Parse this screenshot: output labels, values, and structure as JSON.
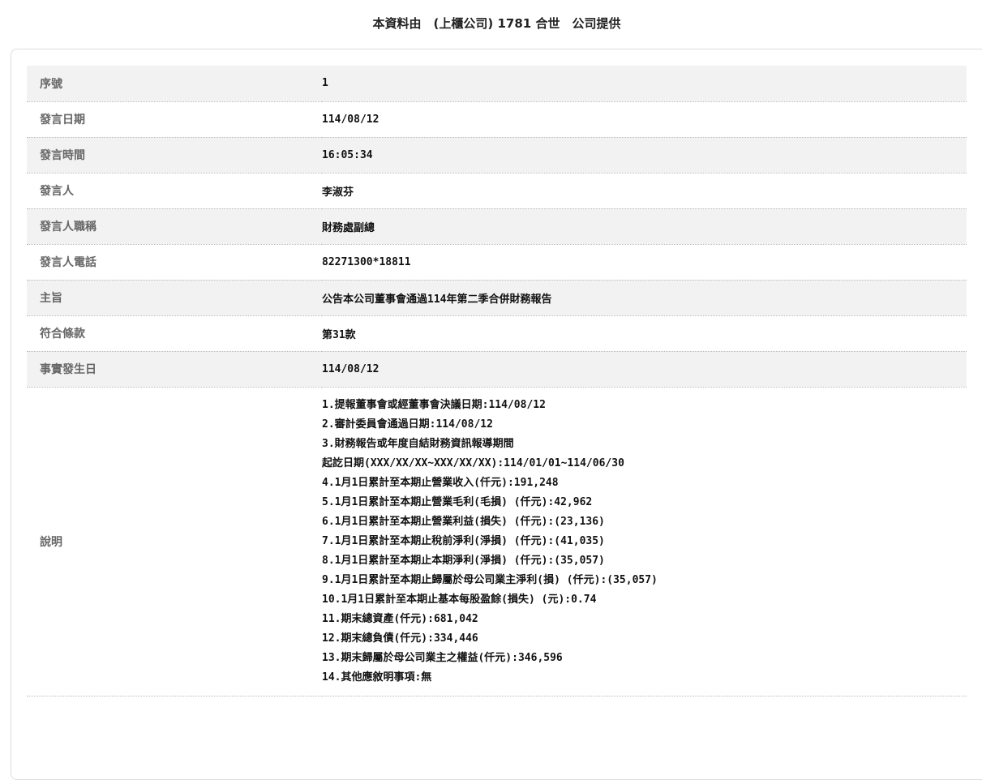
{
  "header": {
    "title": "本資料由　(上櫃公司) 1781 合世　公司提供"
  },
  "rows": [
    {
      "label": "序號",
      "value": "1"
    },
    {
      "label": "發言日期",
      "value": "114/08/12"
    },
    {
      "label": "發言時間",
      "value": "16:05:34"
    },
    {
      "label": "發言人",
      "value": "李淑芬"
    },
    {
      "label": "發言人職稱",
      "value": "財務處副總"
    },
    {
      "label": "發言人電話",
      "value": "82271300*18811"
    },
    {
      "label": "主旨",
      "value": "公告本公司董事會通過114年第二季合併財務報告"
    },
    {
      "label": "符合條款",
      "value": "第31款"
    },
    {
      "label": "事實發生日",
      "value": "114/08/12"
    }
  ],
  "description": {
    "label": "說明",
    "lines": [
      "1.提報董事會或經董事會決議日期:114/08/12",
      "2.審計委員會通過日期:114/08/12",
      "3.財務報告或年度自結財務資訊報導期間",
      "起訖日期(XXX/XX/XX~XXX/XX/XX):114/01/01~114/06/30",
      "4.1月1日累計至本期止營業收入(仟元):191,248",
      "5.1月1日累計至本期止營業毛利(毛損) (仟元):42,962",
      "6.1月1日累計至本期止營業利益(損失) (仟元):(23,136)",
      "7.1月1日累計至本期止稅前淨利(淨損) (仟元):(41,035)",
      "8.1月1日累計至本期止本期淨利(淨損) (仟元):(35,057)",
      "9.1月1日累計至本期止歸屬於母公司業主淨利(損) (仟元):(35,057)",
      "10.1月1日累計至本期止基本每股盈餘(損失) (元):0.74",
      "11.期末總資產(仟元):681,042",
      "12.期末總負債(仟元):334,446",
      "13.期末歸屬於母公司業主之權益(仟元):346,596",
      "14.其他應敘明事項:無"
    ]
  }
}
